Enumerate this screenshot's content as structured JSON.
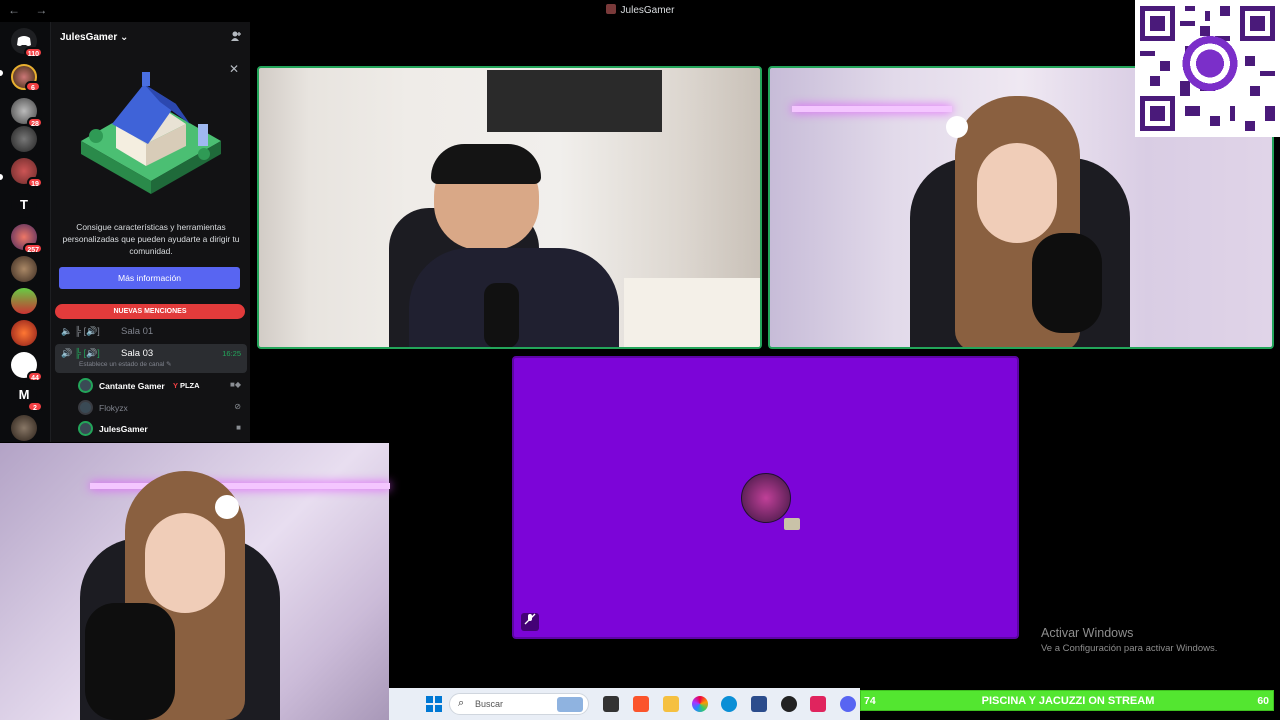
{
  "window": {
    "title": "JulesGamer",
    "back": "←",
    "forward": "→"
  },
  "rail": {
    "badges": [
      "110",
      "6",
      "28",
      "19",
      "257",
      "44",
      "2"
    ],
    "letter_server": "T",
    "m_server": "M"
  },
  "sidebar": {
    "server_name": "JulesGamer ⌄",
    "promo": {
      "text": "Consigue características y herramientas personalizadas que pueden ayudarte a dirigir tu comunidad.",
      "button": "Más información"
    },
    "mentions_label": "NUEVAS MENCIONES",
    "channels": [
      {
        "name": "Sala 01"
      },
      {
        "name": "Sala 03",
        "time": "16:25",
        "status": "Establece un estado de canal ✎"
      }
    ],
    "voice_users": [
      {
        "name": "Cantante Gamer",
        "tag": "PLZA"
      },
      {
        "name": "Flokyzx"
      },
      {
        "name": "JulesGamer"
      }
    ]
  },
  "watermark": {
    "title": "Activar Windows",
    "subtitle": "Ve a Configuración para activar Windows."
  },
  "taskbar": {
    "search_placeholder": "Buscar"
  },
  "ticker": {
    "left": "74",
    "text": "PISCINA Y JACUZZI ON STREAM",
    "right": "60"
  },
  "colors": {
    "speaking_border": "#23a55a",
    "screen_share_bg": "#7c05d8",
    "mentions": "#e23b3b",
    "ticker": "#53e630",
    "blurple": "#5865f2"
  }
}
